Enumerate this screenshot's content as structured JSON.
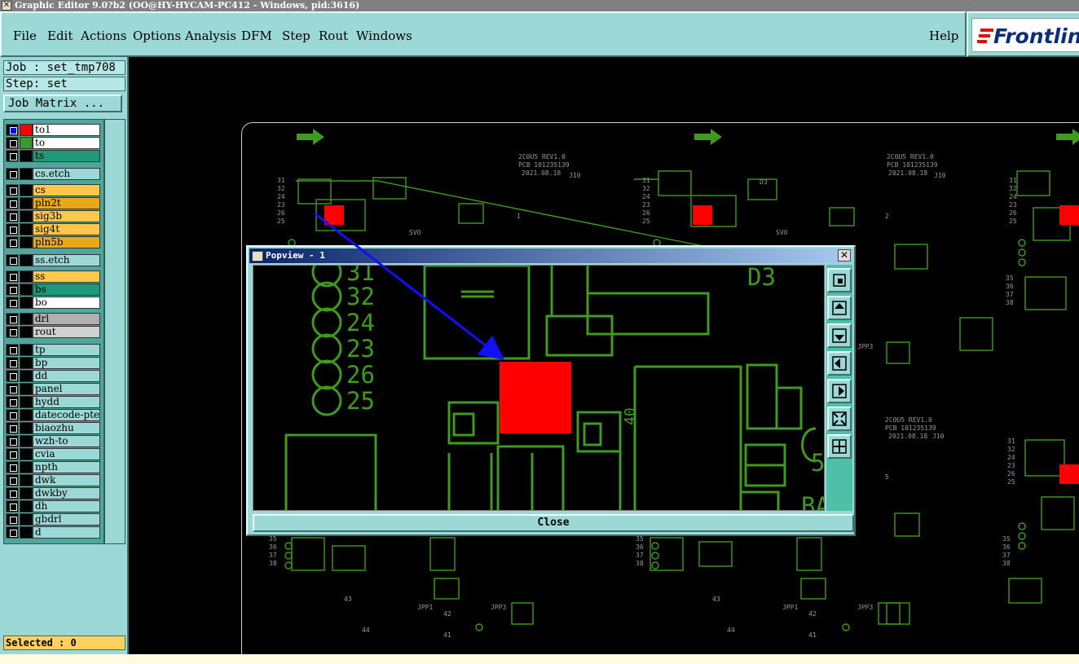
{
  "window": {
    "title": "Graphic Editor 9.0?b2 (OO@HY-HYCAM-PC412 - Windows, pid:3616)"
  },
  "menu": {
    "items": [
      "File",
      "Edit",
      "Actions",
      "Options",
      "Analysis",
      "DFM",
      "Step",
      "Rout",
      "Windows"
    ],
    "help": "Help"
  },
  "logo": {
    "text": "Frontline"
  },
  "job": {
    "label": "Job : set_tmp708",
    "step": "Step: set",
    "matrix_button": "Job Matrix ..."
  },
  "layers": [
    {
      "name": "to1",
      "color": "#ff0000",
      "bg": "#ffffff",
      "on": true
    },
    {
      "name": "to",
      "color": "#3a9a2a",
      "bg": "#ffffff",
      "on": false
    },
    {
      "name": "ts",
      "color": "",
      "bg": "#1e9a78",
      "on": false
    },
    {
      "name": "cs.etch",
      "color": "",
      "bg": "#9bd8d6",
      "on": false
    },
    {
      "name": "cs",
      "color": "",
      "bg": "#ffc84a",
      "on": false
    },
    {
      "name": "pln2t",
      "color": "",
      "bg": "#e8a818",
      "on": false
    },
    {
      "name": "sig3b",
      "color": "",
      "bg": "#ffc84a",
      "on": false
    },
    {
      "name": "sig4t",
      "color": "",
      "bg": "#ffc84a",
      "on": false
    },
    {
      "name": "pln5b",
      "color": "",
      "bg": "#e8a818",
      "on": false
    },
    {
      "name": "ss.etch",
      "color": "",
      "bg": "#9bd8d6",
      "on": false
    },
    {
      "name": "ss",
      "color": "",
      "bg": "#ffc84a",
      "on": false
    },
    {
      "name": "bs",
      "color": "",
      "bg": "#1e9a78",
      "on": false
    },
    {
      "name": "bo",
      "color": "",
      "bg": "#ffffff",
      "on": false
    },
    {
      "name": "drl",
      "color": "",
      "bg": "#b0b0b0",
      "on": false
    },
    {
      "name": "rout",
      "color": "",
      "bg": "#d0d0d0",
      "on": false
    },
    {
      "name": "tp",
      "color": "",
      "bg": "#9bd8d6",
      "on": false
    },
    {
      "name": "bp",
      "color": "",
      "bg": "#9bd8d6",
      "on": false
    },
    {
      "name": "dd",
      "color": "",
      "bg": "#9bd8d6",
      "on": false
    },
    {
      "name": "panel",
      "color": "",
      "bg": "#9bd8d6",
      "on": false
    },
    {
      "name": "hydd",
      "color": "",
      "bg": "#9bd8d6",
      "on": false
    },
    {
      "name": "datecode-pte",
      "color": "",
      "bg": "#9bd8d6",
      "on": false
    },
    {
      "name": "biaozhu",
      "color": "",
      "bg": "#9bd8d6",
      "on": false
    },
    {
      "name": "wzh-to",
      "color": "",
      "bg": "#9bd8d6",
      "on": false
    },
    {
      "name": "cvia",
      "color": "",
      "bg": "#9bd8d6",
      "on": false
    },
    {
      "name": "npth",
      "color": "",
      "bg": "#9bd8d6",
      "on": false
    },
    {
      "name": "dwk",
      "color": "",
      "bg": "#9bd8d6",
      "on": false
    },
    {
      "name": "dwkby",
      "color": "",
      "bg": "#9bd8d6",
      "on": false
    },
    {
      "name": "dh",
      "color": "",
      "bg": "#9bd8d6",
      "on": false
    },
    {
      "name": "gbdrl",
      "color": "",
      "bg": "#9bd8d6",
      "on": false
    },
    {
      "name": "d",
      "color": "",
      "bg": "#9bd8d6",
      "on": false
    }
  ],
  "status": {
    "selected": "Selected : 0"
  },
  "board": {
    "rev": "2C0U5 REV1.0",
    "pcb": "PCB 101235139",
    "date": "2021.08.18",
    "j10": "J10",
    "u1": "1",
    "u2": "2",
    "u5": "5",
    "svo": "SVO",
    "jpp1": "JPP1",
    "jpp3": "JPP3",
    "n43": "43",
    "n44": "44",
    "n42": "42",
    "n41": "41",
    "d3": "D3",
    "pins_a": [
      "31",
      "32",
      "24",
      "23",
      "26",
      "25"
    ],
    "pins_b": [
      "35",
      "36",
      "37",
      "38"
    ]
  },
  "popview": {
    "title": "Popview - 1",
    "close": "Close",
    "labels": {
      "d3": "D3",
      "n40": "40",
      "n5": "5",
      "ba": "BA"
    },
    "pins": [
      "31",
      "32",
      "24",
      "23",
      "26",
      "25"
    ],
    "tools": [
      "zoom-window-icon",
      "pan-up-icon",
      "pan-down-icon",
      "pan-left-icon",
      "pan-right-icon",
      "zoom-fit-icon",
      "zoom-in-icon"
    ]
  },
  "colors": {
    "trace": "#3f9a1e",
    "pad": "#ff0000",
    "panel": "#9bd8d6"
  }
}
